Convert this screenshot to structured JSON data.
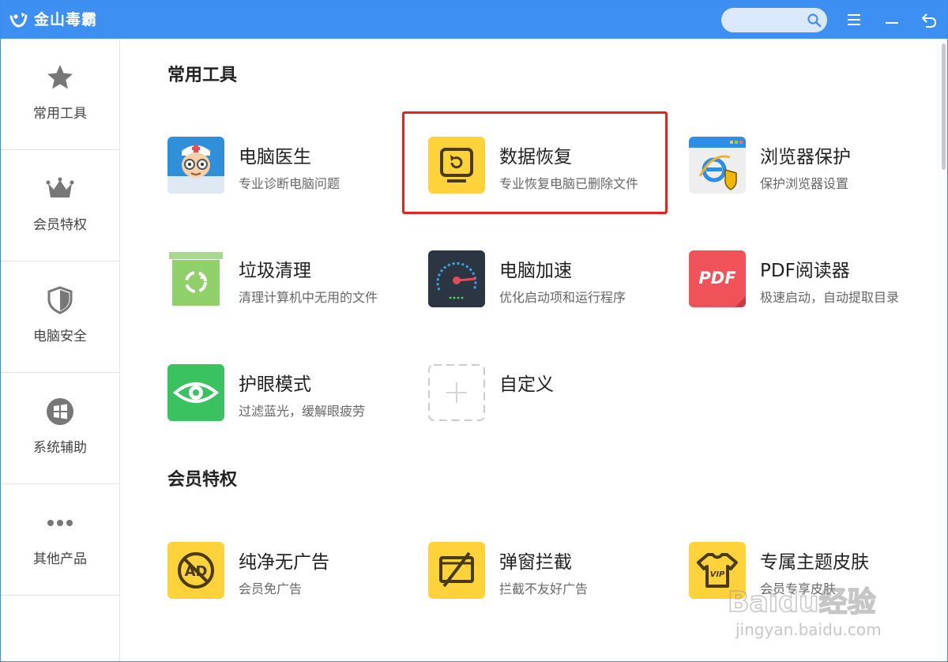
{
  "app": {
    "title": "金山毒霸"
  },
  "search": {
    "placeholder": "",
    "value": ""
  },
  "sidebar": {
    "items": [
      {
        "label": "常用工具",
        "icon": "star-icon"
      },
      {
        "label": "会员特权",
        "icon": "crown-icon"
      },
      {
        "label": "电脑安全",
        "icon": "shield-icon"
      },
      {
        "label": "系统辅助",
        "icon": "windows-icon"
      },
      {
        "label": "其他产品",
        "icon": "more-dots-icon"
      }
    ]
  },
  "sections": {
    "common": {
      "title": "常用工具",
      "tools": [
        {
          "name": "电脑医生",
          "desc": "专业诊断电脑问题",
          "icon": "doctor-icon"
        },
        {
          "name": "数据恢复",
          "desc": "专业恢复电脑已删除文件",
          "icon": "data-recovery-icon"
        },
        {
          "name": "浏览器保护",
          "desc": "保护浏览器设置",
          "icon": "browser-protect-icon"
        },
        {
          "name": "垃圾清理",
          "desc": "清理计算机中无用的文件",
          "icon": "trash-clean-icon"
        },
        {
          "name": "电脑加速",
          "desc": "优化启动项和运行程序",
          "icon": "speedometer-icon"
        },
        {
          "name": "PDF阅读器",
          "desc": "极速启动，自动提取目录",
          "icon": "pdf-icon",
          "icon_text": "PDF"
        },
        {
          "name": "护眼模式",
          "desc": "过滤蓝光，缓解眼疲劳",
          "icon": "eye-icon"
        },
        {
          "name": "自定义",
          "desc": "",
          "icon": "plus-icon"
        }
      ]
    },
    "member": {
      "title": "会员特权",
      "tools": [
        {
          "name": "纯净无广告",
          "desc": "会员免广告",
          "icon": "no-ads-icon",
          "icon_text": "AD"
        },
        {
          "name": "弹窗拦截",
          "desc": "拦截不友好广告",
          "icon": "popup-block-icon"
        },
        {
          "name": "专属主题皮肤",
          "desc": "会员专享皮肤",
          "icon": "tshirt-vip-icon",
          "icon_text": "VIP"
        }
      ]
    }
  },
  "watermark": {
    "line1": "Baidu经验",
    "line2": "jingyan.baidu.com"
  },
  "colors": {
    "titlebar": "#3d8ff2",
    "highlight": "#e8231f",
    "member_yellow": "#fdd23a"
  }
}
